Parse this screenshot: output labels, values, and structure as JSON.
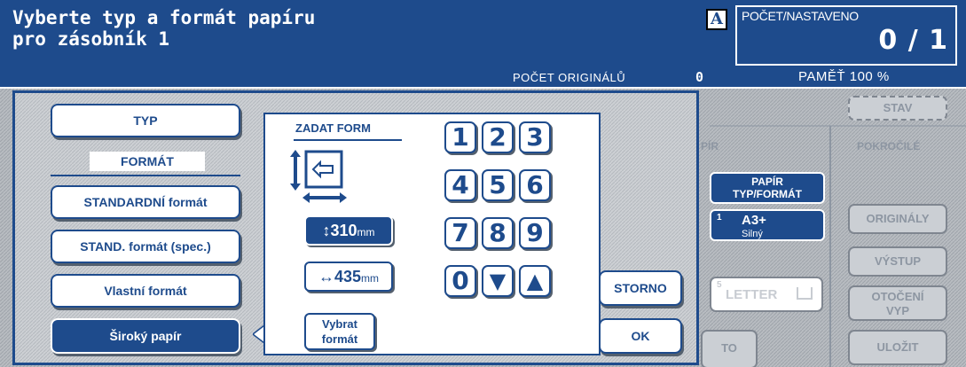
{
  "header": {
    "title": "Vyberte typ a formát papíru\npro zásobník 1",
    "mode_letter": "A",
    "count_label": "POČET/NASTAVENO",
    "count_value": "0 / 1",
    "originals_label": "POČET ORIGINÁLŮ",
    "originals_value": "0",
    "memory": "PAMĚŤ 100 %"
  },
  "background": {
    "status_button": "STAV",
    "tab_paper": "PÍR",
    "tab_advanced": "POKROČILÉ",
    "paper_type_format": "PAPÍR\nTYP/FORMÁT",
    "tray_number": "1",
    "tray_size": "A3+",
    "tray_type": "Silný",
    "letter_number": "5",
    "letter_label": "LETTER",
    "auto_partial": "TO",
    "right_buttons": [
      "ORIGINÁLY",
      "VÝSTUP",
      "OTOČENÍ\nVYP",
      "ULOŽIT"
    ]
  },
  "left_panel": {
    "type_button": "TYP",
    "format_label": "FORMÁT",
    "buttons": [
      "STANDARDNÍ formát",
      "STAND. formát (spec.)",
      "Vlastní formát",
      "Široký papír"
    ],
    "selected_index": 3
  },
  "keypad": {
    "title": "ZADAT FORM",
    "height_value": "310",
    "width_value": "435",
    "unit": "mm",
    "select_button": "Vybrat\nformát",
    "keys": [
      "1",
      "2",
      "3",
      "4",
      "5",
      "6",
      "7",
      "8",
      "9",
      "0",
      "▼",
      "▲"
    ]
  },
  "actions": {
    "cancel": "STORNO",
    "ok": "OK"
  },
  "colors": {
    "accent": "#1e4b8c",
    "panel": "#c8cbd0",
    "background_pane": "#b2b6bb"
  }
}
